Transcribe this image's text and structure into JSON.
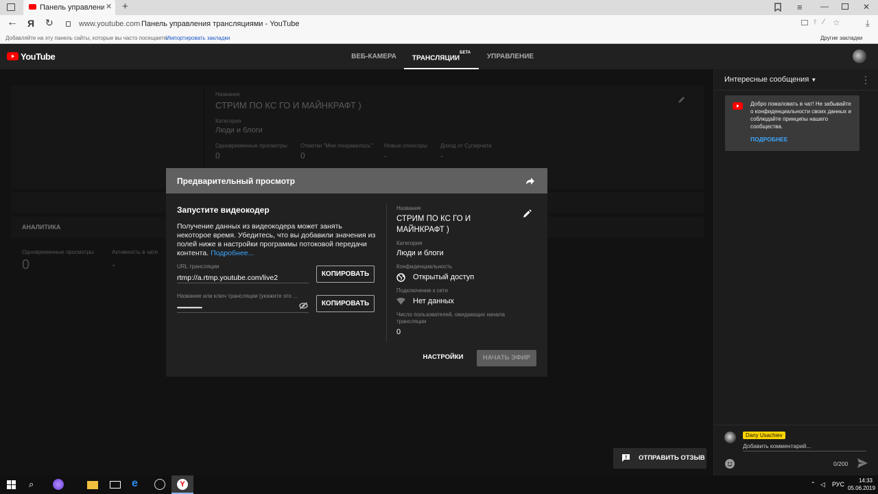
{
  "browser": {
    "tab_title": "Панель управления тра",
    "url_domain": "www.youtube.com",
    "url_title": "Панель управления трансляциями - YouTube",
    "bookmarks_hint": "Добавляйте на эту панель сайты, которые вы часто посещаете.",
    "bookmarks_import": "Импортировать закладки",
    "other_bookmarks": "Другие закладки",
    "yandex_letter": "Я"
  },
  "header": {
    "logo_text": "YouTube",
    "tabs": [
      {
        "label": "ВЕБ-КАМЕРА"
      },
      {
        "label": "ТРАНСЛЯЦИИ",
        "badge": "БЕТА"
      },
      {
        "label": "УПРАВЛЕНИЕ"
      }
    ]
  },
  "background": {
    "name_label": "Название",
    "name_value": "СТРИМ ПО КС ГО И МАЙНКРАФТ )",
    "category_label": "Категория",
    "category_value": "Люди и блоги",
    "stats": [
      {
        "label": "Одновременные просмотры",
        "value": "0"
      },
      {
        "label": "Отметки \"Мне понравилось\"",
        "value": "0"
      },
      {
        "label": "Новые спонсоры",
        "value": "-"
      },
      {
        "label": "Доход от Суперчата",
        "value": "-"
      }
    ],
    "analytics_title": "АНАЛИТИКА",
    "analytics_stats": [
      {
        "label": "Одновременные просмотры",
        "value": "0"
      },
      {
        "label": "Активность в чате",
        "value": "-"
      }
    ]
  },
  "modal": {
    "title": "Предварительный просмотр",
    "section_title": "Запустите видеокодер",
    "description": "Получение данных из видеокодера может занять некоторое время. Убедитесь, что вы добавили значения из полей ниже в настройки программы потоковой передачи контента.",
    "more_link": "Подробнее...",
    "url_label": "URL трансляции",
    "url_value": "rtmp://a.rtmp.youtube.com/live2",
    "copy_label": "КОПИРОВАТЬ",
    "key_label": "Название или ключ трансляции (укажите это ...",
    "key_value": "••••••••••••••••••••",
    "copy_label_2": "КОПИРОВАТЬ",
    "info": {
      "name_label": "Название",
      "name_value": "СТРИМ ПО КС ГО И МАЙНКРАФТ )",
      "category_label": "Категория",
      "category_value": "Люди и блоги",
      "privacy_label": "Конфиденциальность",
      "privacy_value": "Открытый доступ",
      "connection_label": "Подключение к сети",
      "connection_value": "Нет данных",
      "waiting_label": "Число пользователей, ожидающих начала трансляции",
      "waiting_value": "0"
    },
    "settings_button": "НАСТРОЙКИ",
    "start_button": "НАЧАТЬ ЭФИР"
  },
  "chat": {
    "header": "Интересные сообщения",
    "welcome": "Добро пожаловать в чат! Не забывайте о конфиденциальности своих данных и соблюдайте принципы нашего сообщества.",
    "learn_more": "ПОДРОБНЕЕ",
    "username": "Dany Usachiev",
    "comment_placeholder": "Добавить комментарий...",
    "char_count": "0/200"
  },
  "feedback_button": "ОТПРАВИТЬ ОТЗЫВ",
  "taskbar": {
    "lang": "РУС",
    "time": "14:33",
    "date": "05.06.2019"
  },
  "colors": {
    "youtube_red": "#ff0000",
    "link_blue": "#3ea6ff",
    "username_badge": "#ffd600"
  }
}
